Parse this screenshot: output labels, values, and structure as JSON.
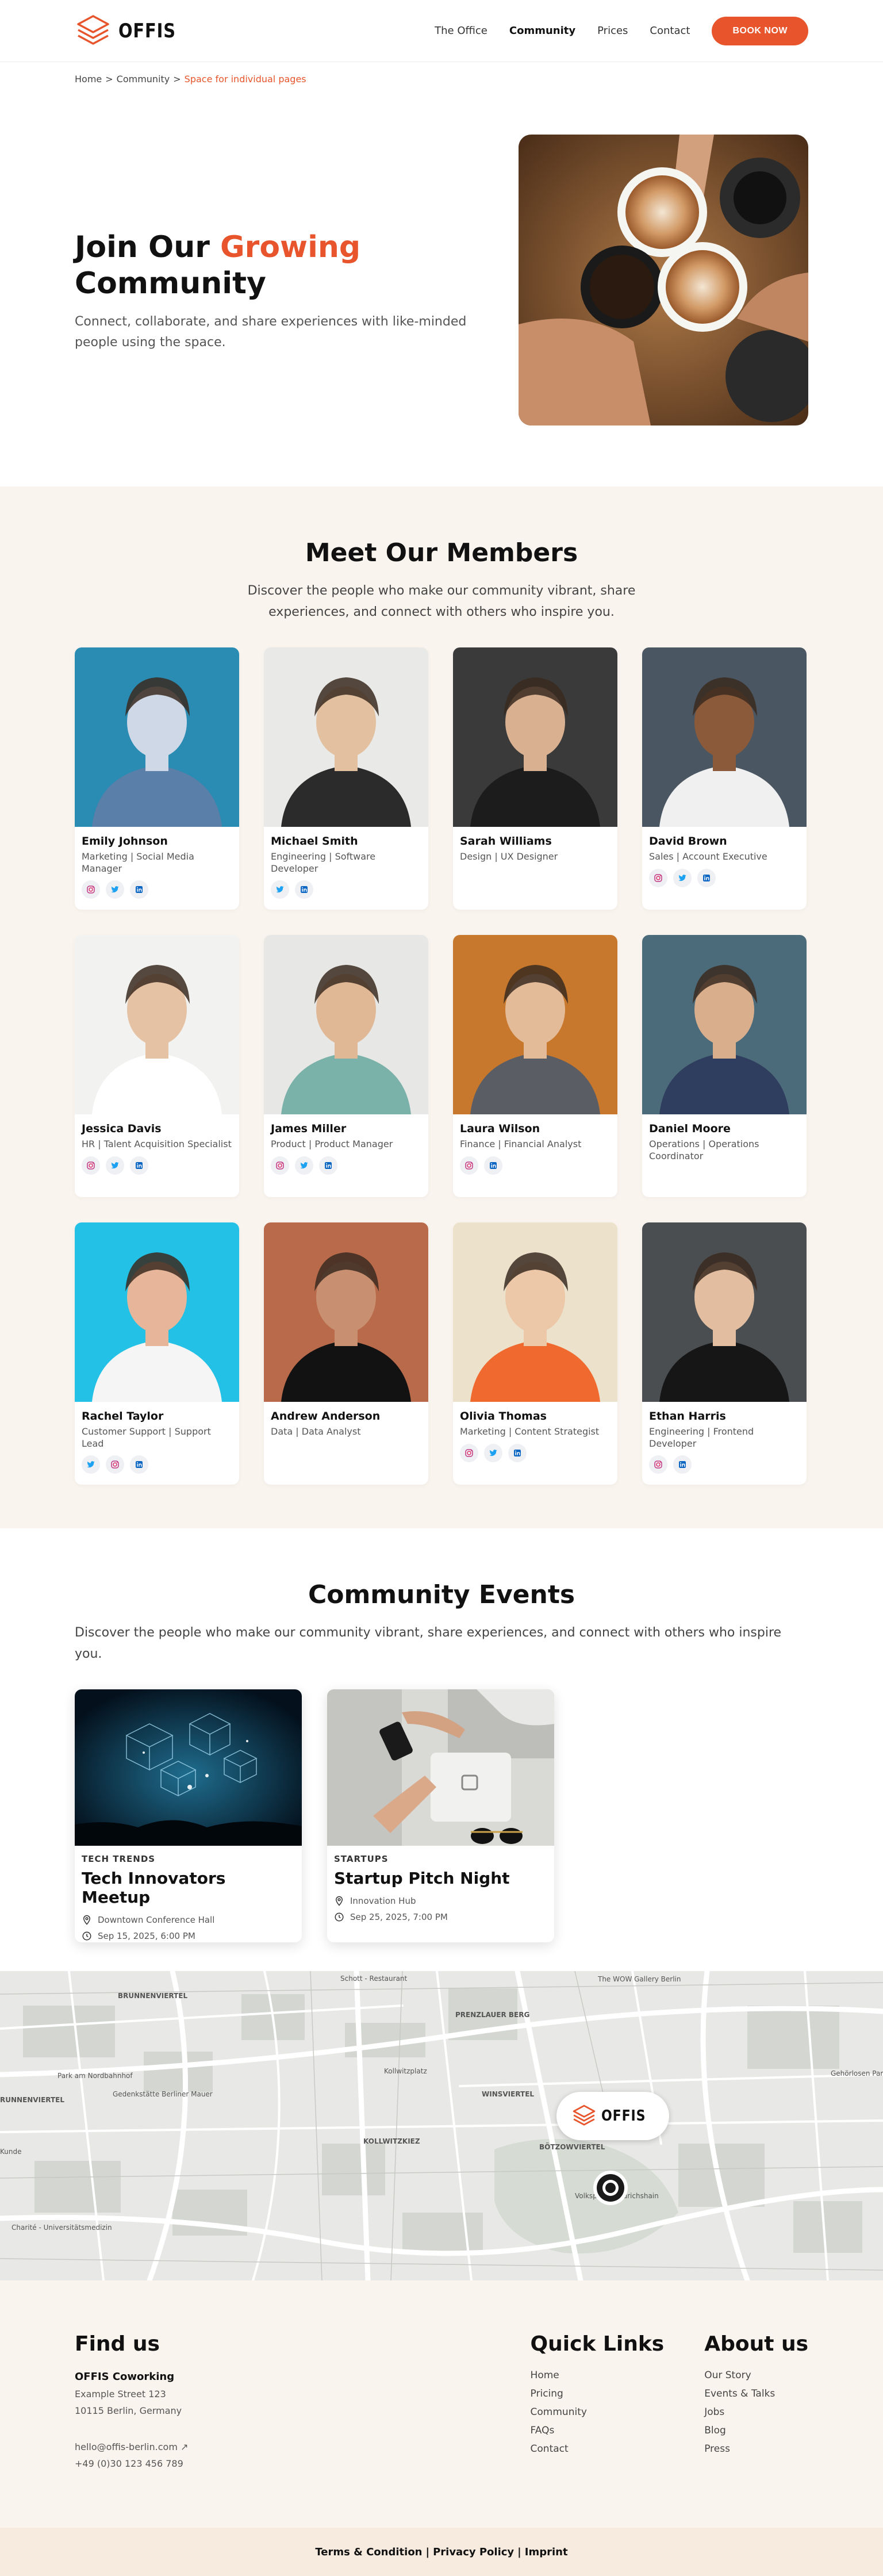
{
  "brand": {
    "name": "OFFIS",
    "accent": "#e8552c"
  },
  "nav": {
    "links": [
      {
        "label": "The Office"
      },
      {
        "label": "Community"
      },
      {
        "label": "Prices"
      },
      {
        "label": "Contact"
      }
    ],
    "cta": "BOOK NOW"
  },
  "breadcrumb": {
    "home": "Home",
    "section": "Community",
    "current": "Space for individual pages",
    "separator": ">"
  },
  "hero": {
    "title_part1": "Join Our",
    "title_accent": "Growing",
    "title_part2": "Community",
    "subtitle": "Connect, collaborate, and share experiences with like-minded people using the space."
  },
  "members": {
    "title": "Meet Our Members",
    "subtitle": "Discover the people who make our community vibrant, share experiences, and connect with others who inspire you.",
    "items": [
      {
        "name": "Emily Johnson",
        "role": "Marketing | Social Media Manager",
        "socials": [
          "instagram-icon",
          "twitter-icon",
          "linkedin-icon"
        ]
      },
      {
        "name": "Michael Smith",
        "role": "Engineering | Software Developer",
        "socials": [
          "twitter-icon",
          "linkedin-icon"
        ]
      },
      {
        "name": "Sarah Williams",
        "role": "Design | UX Designer",
        "socials": []
      },
      {
        "name": "David Brown",
        "role": "Sales | Account Executive",
        "socials": [
          "instagram-icon",
          "twitter-icon",
          "linkedin-icon"
        ]
      },
      {
        "name": "Jessica Davis",
        "role": "HR | Talent Acquisition Specialist",
        "socials": [
          "instagram-icon",
          "twitter-icon",
          "linkedin-icon"
        ]
      },
      {
        "name": "James Miller",
        "role": "Product | Product Manager",
        "socials": [
          "instagram-icon",
          "twitter-icon",
          "linkedin-icon"
        ]
      },
      {
        "name": "Laura Wilson",
        "role": "Finance | Financial Analyst",
        "socials": [
          "instagram-icon",
          "linkedin-icon"
        ]
      },
      {
        "name": "Daniel Moore",
        "role": "Operations | Operations Coordinator",
        "socials": []
      },
      {
        "name": "Rachel Taylor",
        "role": "Customer Support | Support Lead",
        "socials": [
          "twitter-icon",
          "instagram-icon",
          "linkedin-icon"
        ]
      },
      {
        "name": "Andrew Anderson",
        "role": "Data | Data Analyst",
        "socials": []
      },
      {
        "name": "Olivia Thomas",
        "role": "Marketing | Content Strategist",
        "socials": [
          "instagram-icon",
          "twitter-icon",
          "linkedin-icon"
        ]
      },
      {
        "name": "Ethan Harris",
        "role": "Engineering | Frontend Developer",
        "socials": [
          "instagram-icon",
          "linkedin-icon"
        ]
      }
    ]
  },
  "events": {
    "title": "Community Events",
    "subtitle": "Discover the people who make our community vibrant, share experiences, and connect with others who inspire you.",
    "items": [
      {
        "category": "TECH TRENDS",
        "title": "Tech Innovators Meetup",
        "location": "Downtown Conference Hall",
        "datetime": "Sep 15, 2025, 6:00 PM"
      },
      {
        "category": "STARTUPS",
        "title": "Startup Pitch Night",
        "location": "Innovation Hub",
        "datetime": "Sep 25, 2025, 7:00 PM"
      }
    ]
  },
  "map": {
    "labels": [
      "BRUNNENVIERTEL",
      "Schott - Restaurant",
      "The WOW Gallery Berlin",
      "PRENZLAUER BERG",
      "Park am Nordbahnhof",
      "Gedenkstätte Berliner Mauer",
      "Kollwitzplatz",
      "WINSVIERTEL",
      "KOLLWITZKIEZ",
      "BÖTZOWVIERTEL",
      "Volkspark Friedrichshain",
      "Charité - Universitätsmedizin",
      "Gehörlosen Park",
      "RUNNENVIERTEL",
      "Kunde"
    ]
  },
  "footer": {
    "find_us": {
      "title": "Find us",
      "company": "OFFIS Coworking",
      "street": "Example Street 123",
      "city": "10115 Berlin, Germany",
      "email": "hello@offis-berlin.com ↗",
      "phone": "+49 (0)30 123 456 789"
    },
    "quick_links": {
      "title": "Quick Links",
      "items": [
        "Home",
        "Pricing",
        "Community",
        "FAQs",
        "Contact"
      ]
    },
    "about": {
      "title": "About us",
      "items": [
        "Our Story",
        "Events & Talks",
        "Jobs",
        "Blog",
        "Press"
      ]
    },
    "bottom": {
      "terms": "Terms & Condition",
      "privacy": "Privacy Policy",
      "imprint": "Imprint",
      "sep": "|"
    }
  }
}
